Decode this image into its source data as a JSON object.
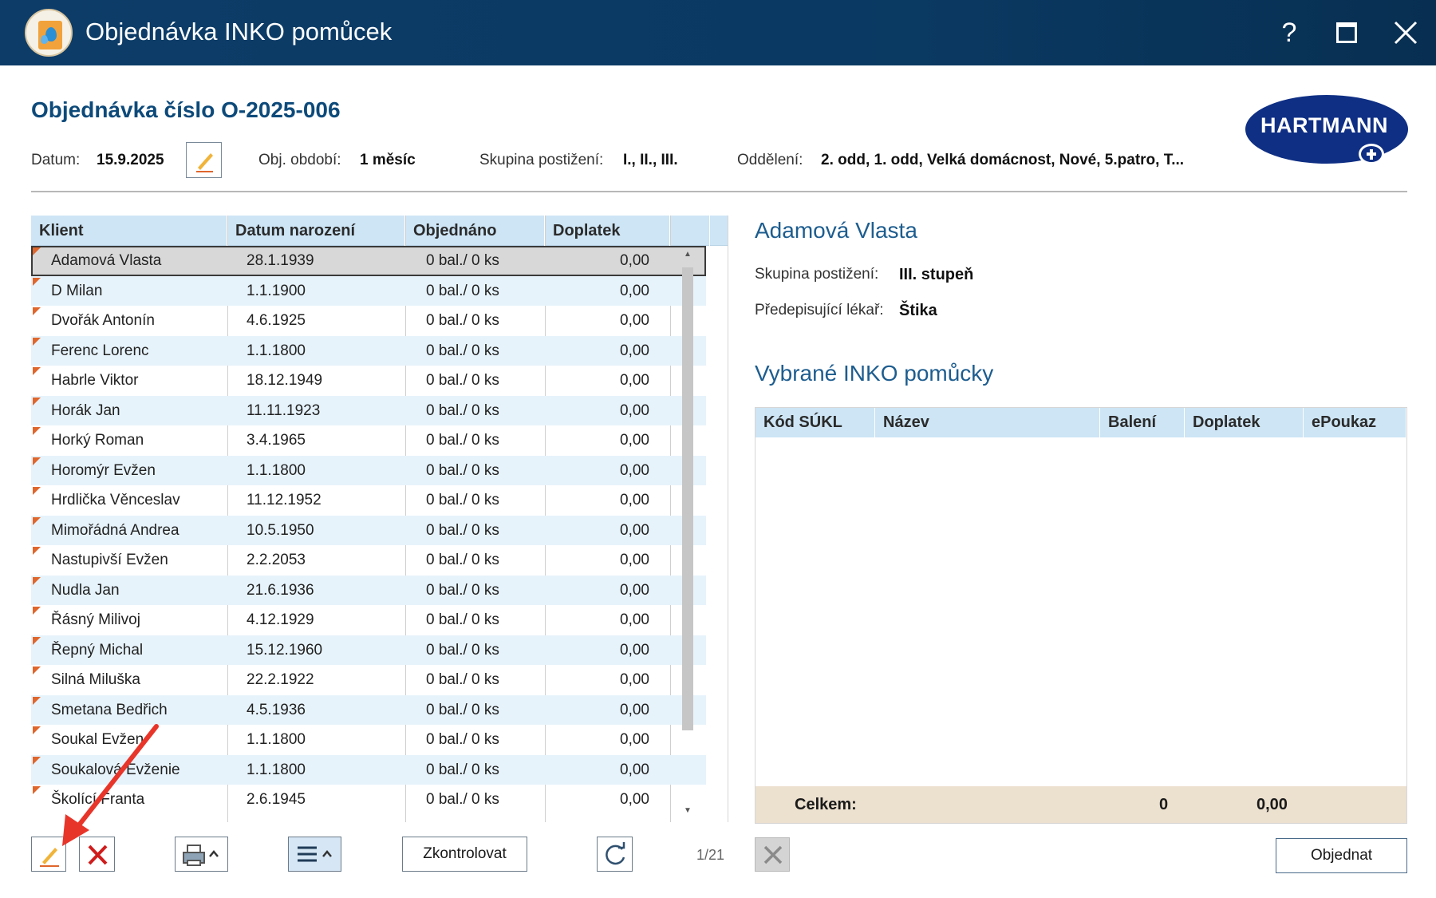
{
  "window": {
    "title": "Objednávka INKO pomůcek",
    "help_glyph": "?"
  },
  "header": {
    "order_title": "Objednávka číslo O-2025-006",
    "date_label": "Datum:",
    "date_value": "15.9.2025",
    "period_label": "Obj. období:",
    "period_value": "1 měsíc",
    "group_label": "Skupina postižení:",
    "group_value": "I., II., III.",
    "dept_label": "Oddělení:",
    "dept_value": "2. odd, 1. odd, Velká domácnost, Nové, 5.patro, T...",
    "logo_text": "HARTMANN"
  },
  "clients_table": {
    "columns": [
      "Klient",
      "Datum narození",
      "Objednáno",
      "Doplatek"
    ],
    "rows": [
      {
        "name": "Adamová Vlasta",
        "dob": "28.1.1939",
        "ordered": "0 bal./ 0 ks",
        "surcharge": "0,00"
      },
      {
        "name": "D Milan",
        "dob": "1.1.1900",
        "ordered": "0 bal./ 0 ks",
        "surcharge": "0,00"
      },
      {
        "name": "Dvořák Antonín",
        "dob": "4.6.1925",
        "ordered": "0 bal./ 0 ks",
        "surcharge": "0,00"
      },
      {
        "name": "Ferenc Lorenc",
        "dob": "1.1.1800",
        "ordered": "0 bal./ 0 ks",
        "surcharge": "0,00"
      },
      {
        "name": "Habrle Viktor",
        "dob": "18.12.1949",
        "ordered": "0 bal./ 0 ks",
        "surcharge": "0,00"
      },
      {
        "name": "Horák Jan",
        "dob": "11.11.1923",
        "ordered": "0 bal./ 0 ks",
        "surcharge": "0,00"
      },
      {
        "name": "Horký Roman",
        "dob": "3.4.1965",
        "ordered": "0 bal./ 0 ks",
        "surcharge": "0,00"
      },
      {
        "name": "Horomýr Evžen",
        "dob": "1.1.1800",
        "ordered": "0 bal./ 0 ks",
        "surcharge": "0,00"
      },
      {
        "name": "Hrdlička Věnceslav",
        "dob": "11.12.1952",
        "ordered": "0 bal./ 0 ks",
        "surcharge": "0,00"
      },
      {
        "name": "Mimořádná Andrea",
        "dob": "10.5.1950",
        "ordered": "0 bal./ 0 ks",
        "surcharge": "0,00"
      },
      {
        "name": "Nastupivší Evžen",
        "dob": "2.2.2053",
        "ordered": "0 bal./ 0 ks",
        "surcharge": "0,00"
      },
      {
        "name": "Nudla Jan",
        "dob": "21.6.1936",
        "ordered": "0 bal./ 0 ks",
        "surcharge": "0,00"
      },
      {
        "name": "Řásný Milivoj",
        "dob": "4.12.1929",
        "ordered": "0 bal./ 0 ks",
        "surcharge": "0,00"
      },
      {
        "name": "Řepný Michal",
        "dob": "15.12.1960",
        "ordered": "0 bal./ 0 ks",
        "surcharge": "0,00"
      },
      {
        "name": "Silná Miluška",
        "dob": "22.2.1922",
        "ordered": "0 bal./ 0 ks",
        "surcharge": "0,00"
      },
      {
        "name": "Smetana Bedřich",
        "dob": "4.5.1936",
        "ordered": "0 bal./ 0 ks",
        "surcharge": "0,00"
      },
      {
        "name": "Soukal Evžen",
        "dob": "1.1.1800",
        "ordered": "0 bal./ 0 ks",
        "surcharge": "0,00"
      },
      {
        "name": "Soukalová Evženie",
        "dob": "1.1.1800",
        "ordered": "0 bal./ 0 ks",
        "surcharge": "0,00"
      },
      {
        "name": "Školící Franta",
        "dob": "2.6.1945",
        "ordered": "0 bal./ 0 ks",
        "surcharge": "0,00"
      }
    ],
    "selected_index": 0
  },
  "toolbar": {
    "check_label": "Zkontrolovat",
    "pager": "1/21"
  },
  "detail": {
    "client_name": "Adamová Vlasta",
    "group_label": "Skupina postižení:",
    "group_value": "III. stupeň",
    "doctor_label": "Předepisující lékař:",
    "doctor_value": "Štika",
    "section_title": "Vybrané INKO pomůcky",
    "columns": [
      "Kód SÚKL",
      "Název",
      "Balení",
      "Doplatek",
      "ePoukaz"
    ],
    "total_label": "Celkem:",
    "total_packs": "0",
    "total_surcharge": "0,00",
    "order_button": "Objednat"
  },
  "colors": {
    "titlebar": "#0d3c68",
    "accent_blue": "#1d5d8f",
    "header_bg": "#cde5f5",
    "row_alt": "#e7f3fb",
    "delete_red": "#d01c1c",
    "annotation_arrow": "#e8352a"
  },
  "icons": [
    "app-icon",
    "help-icon",
    "maximize-icon",
    "close-icon",
    "pencil-icon",
    "delete-icon",
    "printer-icon",
    "menu-icon",
    "refresh-icon",
    "clear-icon"
  ]
}
